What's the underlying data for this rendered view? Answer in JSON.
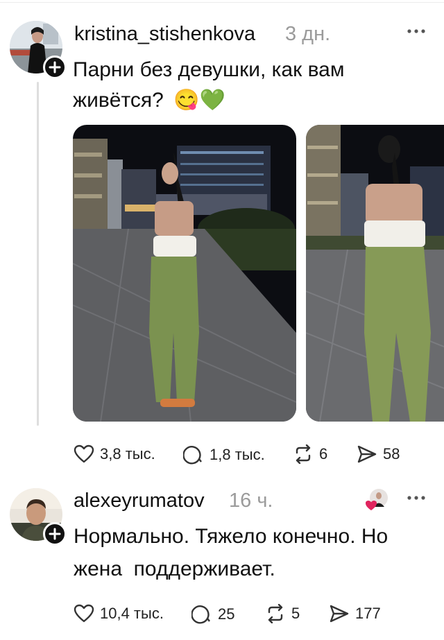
{
  "post": {
    "username": "kristina_stishenkova",
    "time": "3 дн.",
    "text_line1": "Парни без девушки, как вам",
    "text_line2": "живётся?",
    "emoji": "😋💚",
    "likes": "3,8 тыс.",
    "replies": "1,8 тыс.",
    "reposts": "6",
    "shares": "58"
  },
  "reply": {
    "username": "alexeyrumatov",
    "time": "16 ч.",
    "text_line1": "Нормально. Тяжело конечно. Но",
    "text_line2": "жена  поддерживает.",
    "likes": "10,4 тыс.",
    "replies": "25",
    "reposts": "5",
    "shares": "177"
  },
  "colors": {
    "text": "#111111",
    "muted": "#9b9b9b",
    "like_heart": "#e0245e"
  },
  "icons": [
    "more-icon",
    "plus-icon",
    "heart-icon",
    "comment-icon",
    "repost-icon",
    "share-icon"
  ]
}
